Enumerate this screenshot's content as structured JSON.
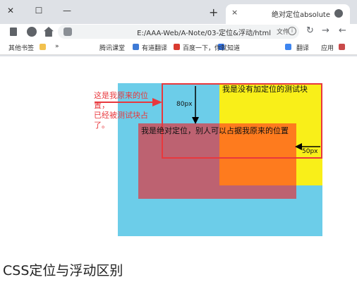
{
  "window_controls": {
    "close": "✕",
    "maximize": "☐",
    "minimize": "—"
  },
  "tab": {
    "title": "绝对定位absolute",
    "new_tab": "+",
    "close": "×"
  },
  "toolbar": {
    "url": "E:/AAA-Web/A-Note/03-定位&浮动/html",
    "url_prefix": "文件",
    "info": "i",
    "back": "←",
    "forward": "→",
    "reload": "↻"
  },
  "bookmarks": {
    "items": [
      "应用",
      "翻译",
      "百度一下，你就知道",
      "有道翻译",
      "腾讯课堂",
      "搜狗翻译"
    ],
    "overflow": "»",
    "other": "其他书签"
  },
  "demo": {
    "static_label": "我是没有加定位的测试块",
    "abs_label": "我是绝对定位，别人可以占据我原来的位置",
    "top_offset": "80px",
    "right_offset": "50px",
    "note_lines": [
      "这是我原来的位置，",
      "已经被测试块占了。"
    ]
  },
  "colors": {
    "outer": "#6ccde9",
    "static": "#f9ef19",
    "overlap": "#fe7b1e",
    "absolute": "#bd6271",
    "annotation": "#e8383d"
  },
  "caption": "CSS定位与浮动区别"
}
